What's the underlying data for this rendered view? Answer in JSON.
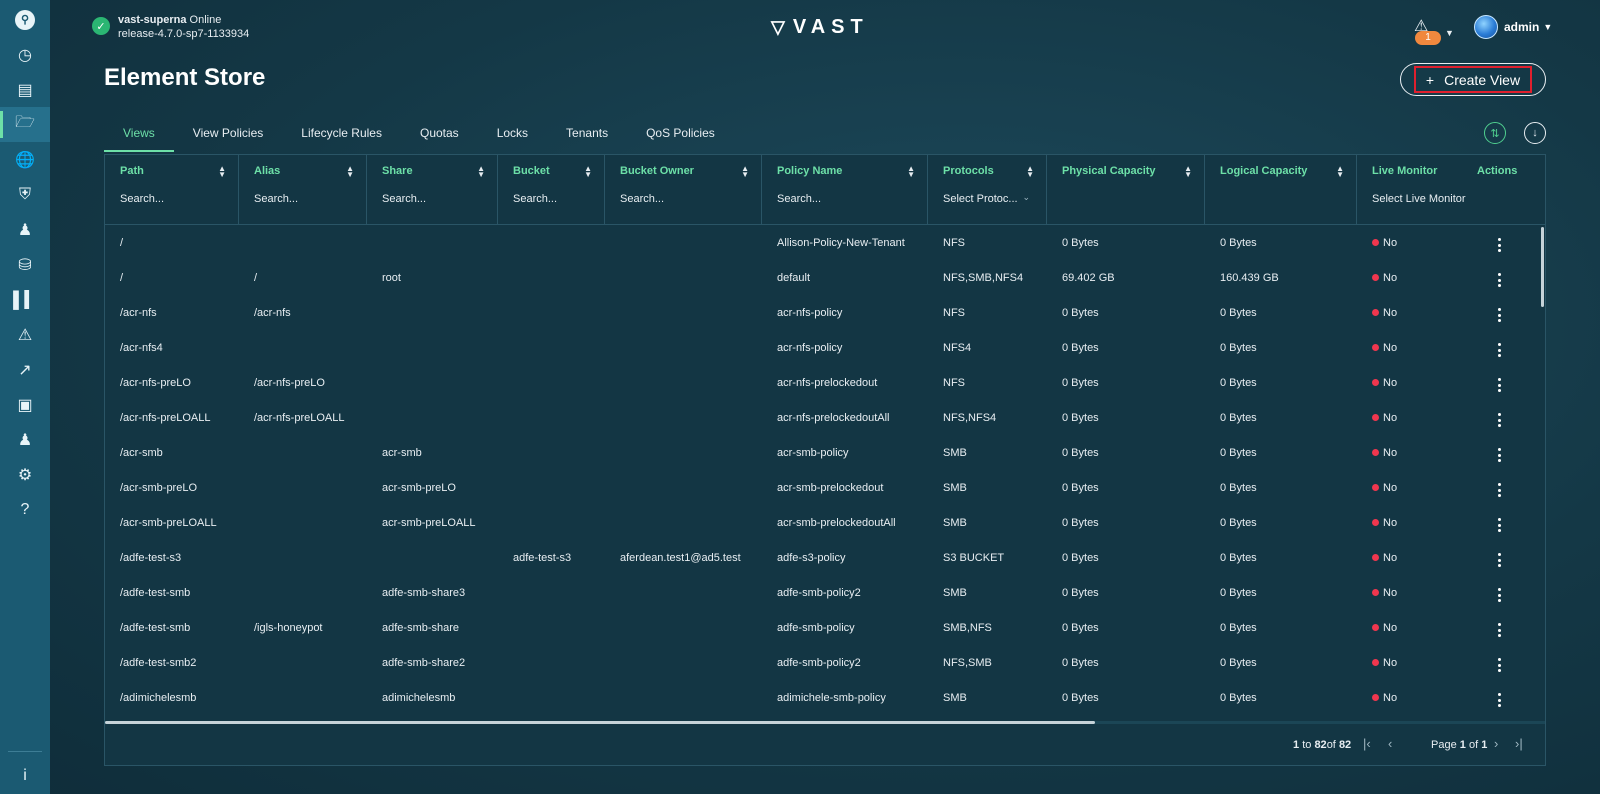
{
  "header": {
    "cluster_name": "vast-superna",
    "cluster_status": "Online",
    "release": "release-4.7.0-sp7-1133934",
    "logo_text": "VAST",
    "alert_count": "1",
    "user": "admin"
  },
  "page": {
    "title": "Element Store",
    "create_label": "Create View"
  },
  "tabs": [
    "Views",
    "View Policies",
    "Lifecycle Rules",
    "Quotas",
    "Locks",
    "Tenants",
    "QoS Policies"
  ],
  "columns": {
    "path": {
      "label": "Path",
      "filter": "Search..."
    },
    "alias": {
      "label": "Alias",
      "filter": "Search..."
    },
    "share": {
      "label": "Share",
      "filter": "Search..."
    },
    "bucket": {
      "label": "Bucket",
      "filter": "Search..."
    },
    "bucket_owner": {
      "label": "Bucket Owner",
      "filter": "Search..."
    },
    "policy": {
      "label": "Policy Name",
      "filter": "Search..."
    },
    "protocols": {
      "label": "Protocols",
      "filter": "Select Protoc..."
    },
    "physical": {
      "label": "Physical Capacity"
    },
    "logical": {
      "label": "Logical Capacity"
    },
    "live": {
      "label": "Live Monitor",
      "filter": "Select Live Monitor"
    },
    "actions": {
      "label": "Actions"
    }
  },
  "rows": [
    {
      "path": "/",
      "alias": "",
      "share": "",
      "bucket": "",
      "owner": "",
      "policy": "Allison-Policy-New-Tenant",
      "protocols": "NFS",
      "physical": "0 Bytes",
      "logical": "0 Bytes",
      "live": "No"
    },
    {
      "path": "/",
      "alias": "/",
      "share": "root",
      "bucket": "",
      "owner": "",
      "policy": "default",
      "protocols": "NFS,SMB,NFS4",
      "physical": "69.402 GB",
      "logical": "160.439 GB",
      "live": "No"
    },
    {
      "path": "/acr-nfs",
      "alias": "/acr-nfs",
      "share": "",
      "bucket": "",
      "owner": "",
      "policy": "acr-nfs-policy",
      "protocols": "NFS",
      "physical": "0 Bytes",
      "logical": "0 Bytes",
      "live": "No"
    },
    {
      "path": "/acr-nfs4",
      "alias": "",
      "share": "",
      "bucket": "",
      "owner": "",
      "policy": "acr-nfs-policy",
      "protocols": "NFS4",
      "physical": "0 Bytes",
      "logical": "0 Bytes",
      "live": "No"
    },
    {
      "path": "/acr-nfs-preLO",
      "alias": "/acr-nfs-preLO",
      "share": "",
      "bucket": "",
      "owner": "",
      "policy": "acr-nfs-prelockedout",
      "protocols": "NFS",
      "physical": "0 Bytes",
      "logical": "0 Bytes",
      "live": "No"
    },
    {
      "path": "/acr-nfs-preLOALL",
      "alias": "/acr-nfs-preLOALL",
      "share": "",
      "bucket": "",
      "owner": "",
      "policy": "acr-nfs-prelockedoutAll",
      "protocols": "NFS,NFS4",
      "physical": "0 Bytes",
      "logical": "0 Bytes",
      "live": "No"
    },
    {
      "path": "/acr-smb",
      "alias": "",
      "share": "acr-smb",
      "bucket": "",
      "owner": "",
      "policy": "acr-smb-policy",
      "protocols": "SMB",
      "physical": "0 Bytes",
      "logical": "0 Bytes",
      "live": "No"
    },
    {
      "path": "/acr-smb-preLO",
      "alias": "",
      "share": "acr-smb-preLO",
      "bucket": "",
      "owner": "",
      "policy": "acr-smb-prelockedout",
      "protocols": "SMB",
      "physical": "0 Bytes",
      "logical": "0 Bytes",
      "live": "No"
    },
    {
      "path": "/acr-smb-preLOALL",
      "alias": "",
      "share": "acr-smb-preLOALL",
      "bucket": "",
      "owner": "",
      "policy": "acr-smb-prelockedoutAll",
      "protocols": "SMB",
      "physical": "0 Bytes",
      "logical": "0 Bytes",
      "live": "No"
    },
    {
      "path": "/adfe-test-s3",
      "alias": "",
      "share": "",
      "bucket": "adfe-test-s3",
      "owner": "aferdean.test1@ad5.test",
      "policy": "adfe-s3-policy",
      "protocols": "S3 BUCKET",
      "physical": "0 Bytes",
      "logical": "0 Bytes",
      "live": "No"
    },
    {
      "path": "/adfe-test-smb",
      "alias": "",
      "share": "adfe-smb-share3",
      "bucket": "",
      "owner": "",
      "policy": "adfe-smb-policy2",
      "protocols": "SMB",
      "physical": "0 Bytes",
      "logical": "0 Bytes",
      "live": "No"
    },
    {
      "path": "/adfe-test-smb",
      "alias": "/igls-honeypot",
      "share": "adfe-smb-share",
      "bucket": "",
      "owner": "",
      "policy": "adfe-smb-policy",
      "protocols": "SMB,NFS",
      "physical": "0 Bytes",
      "logical": "0 Bytes",
      "live": "No"
    },
    {
      "path": "/adfe-test-smb2",
      "alias": "",
      "share": "adfe-smb-share2",
      "bucket": "",
      "owner": "",
      "policy": "adfe-smb-policy2",
      "protocols": "NFS,SMB",
      "physical": "0 Bytes",
      "logical": "0 Bytes",
      "live": "No"
    },
    {
      "path": "/adimichelesmb",
      "alias": "",
      "share": "adimichelesmb",
      "bucket": "",
      "owner": "",
      "policy": "adimichele-smb-policy",
      "protocols": "SMB",
      "physical": "0 Bytes",
      "logical": "0 Bytes",
      "live": "No"
    }
  ],
  "footer": {
    "range_start": "1",
    "range_end": "82",
    "total": "82",
    "to_word": "to",
    "of_word": "of",
    "page_word": "Page",
    "page_current": "1",
    "page_total": "1"
  },
  "colors": {
    "accent": "#6de0a8",
    "sidebar": "#1b5a72",
    "live_dot": "#f0364e",
    "highlight": "#e0202e"
  }
}
